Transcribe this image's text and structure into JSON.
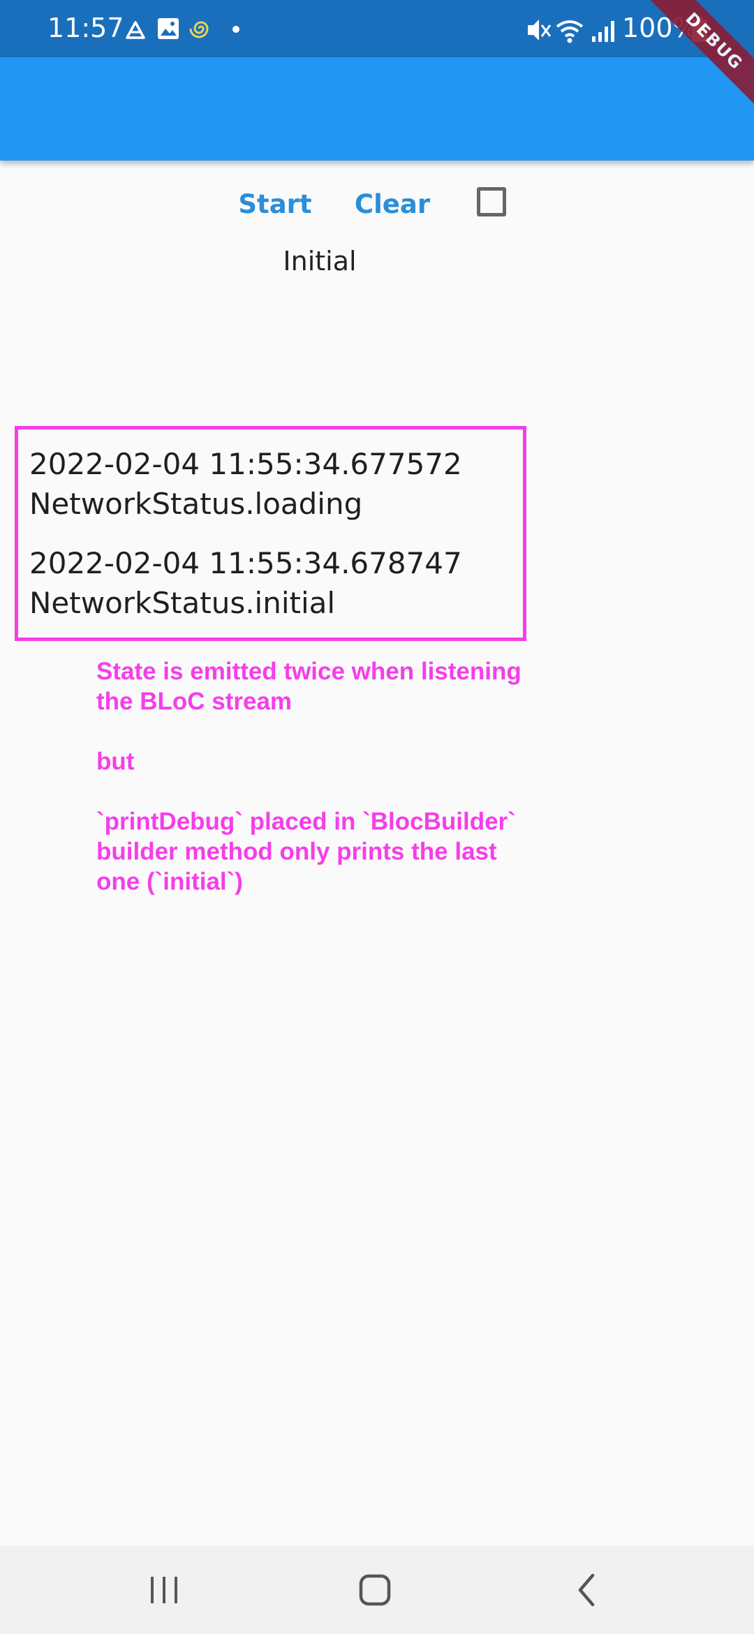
{
  "status_bar": {
    "time": "11:57",
    "battery": "100%",
    "left_icons": [
      "drive-icon",
      "image-icon",
      "spiral-icon",
      "dot-icon"
    ],
    "right_icons": [
      "mute-icon",
      "wifi-icon",
      "signal-icon",
      "battery-icon"
    ]
  },
  "debug_banner": "DEBUG",
  "toolbar": {
    "start_label": "Start",
    "clear_label": "Clear",
    "checkbox_checked": false
  },
  "state_label": "Initial",
  "log": [
    {
      "timestamp": "2022-02-04 11:55:34.677572",
      "status": "NetworkStatus.loading"
    },
    {
      "timestamp": "2022-02-04 11:55:34.678747",
      "status": "NetworkStatus.initial"
    }
  ],
  "annotation": {
    "para1": "State is emitted twice when listening the BLoC stream",
    "para2": "but",
    "para3": "`printDebug` placed in `BlocBuilder` builder method only prints the last one (`initial`)"
  },
  "colors": {
    "status_bar": "#1a6fbd",
    "app_bar": "#2196f3",
    "accent_text": "#2a8ed9",
    "annotation": "#f53ee9",
    "debug_banner": "#8a1c34"
  },
  "nav_bar": {
    "icons": [
      "recents-icon",
      "home-icon",
      "back-icon"
    ]
  }
}
